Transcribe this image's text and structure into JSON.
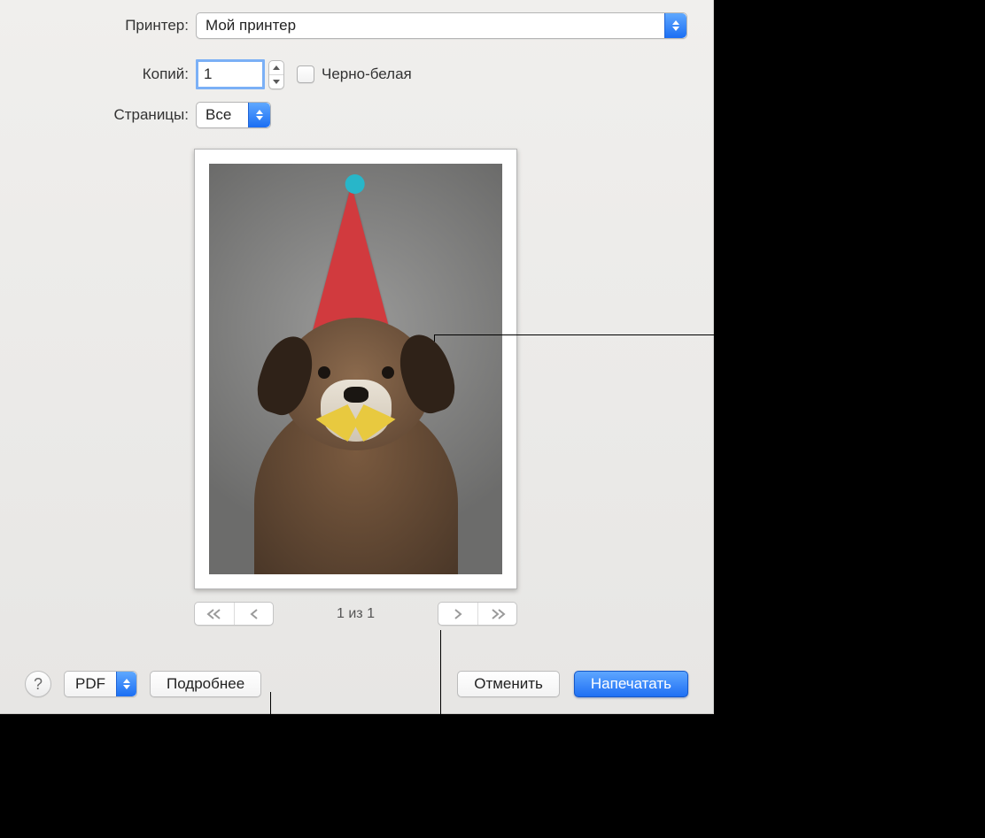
{
  "labels": {
    "printer": "Принтер:",
    "copies": "Копий:",
    "pages": "Страницы:",
    "bw": "Черно-белая"
  },
  "printer": {
    "selected": "Мой принтер"
  },
  "copies": {
    "value": "1"
  },
  "pages": {
    "selected": "Все"
  },
  "pager": {
    "status": "1 из 1"
  },
  "buttons": {
    "pdf": "PDF",
    "details": "Подробнее",
    "cancel": "Отменить",
    "print": "Напечатать",
    "help": "?"
  }
}
